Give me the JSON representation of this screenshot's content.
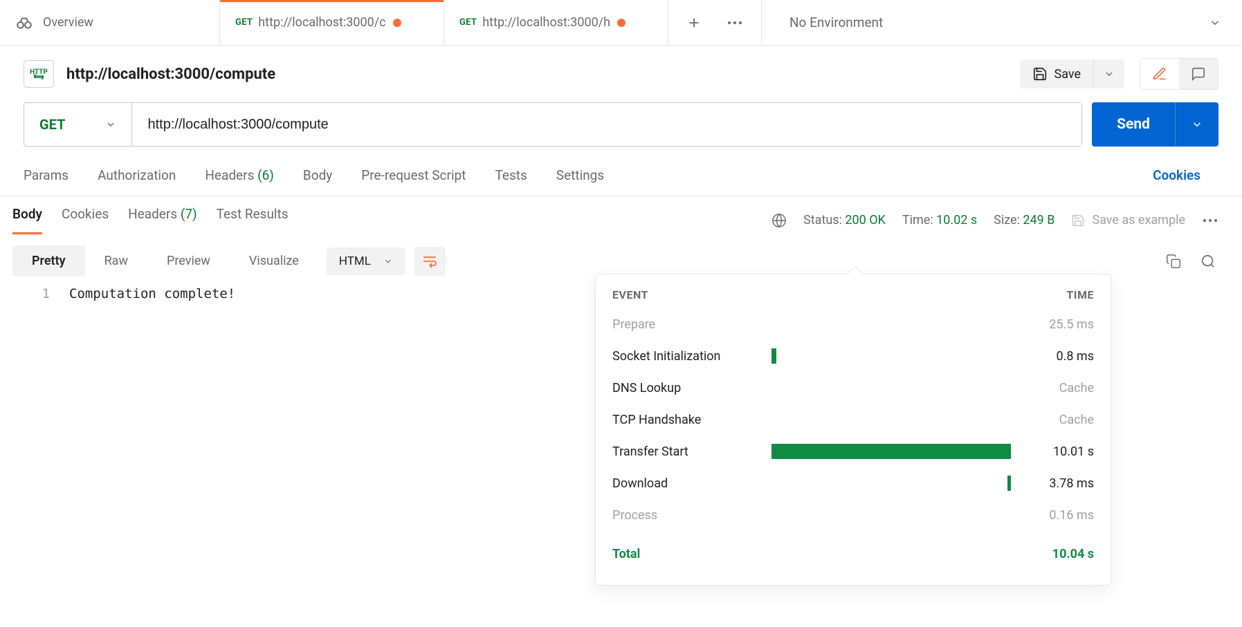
{
  "tabs": {
    "overview": "Overview",
    "items": [
      {
        "method": "GET",
        "label": "http://localhost:3000/c"
      },
      {
        "method": "GET",
        "label": "http://localhost:3000/h"
      }
    ]
  },
  "env": {
    "label": "No Environment"
  },
  "request": {
    "http_badge": "HTTP",
    "title": "http://localhost:3000/compute",
    "save_label": "Save",
    "method": "GET",
    "url": "http://localhost:3000/compute",
    "send": "Send"
  },
  "req_tabs": {
    "params": "Params",
    "authorization": "Authorization",
    "headers_label": "Headers",
    "headers_count": "(6)",
    "body": "Body",
    "prerequest": "Pre-request Script",
    "tests": "Tests",
    "settings": "Settings",
    "cookies": "Cookies"
  },
  "resp_tabs": {
    "body": "Body",
    "cookies": "Cookies",
    "headers_label": "Headers",
    "headers_count": "(7)",
    "test_results": "Test Results"
  },
  "resp_meta": {
    "status_label": "Status:",
    "status_val": "200 OK",
    "time_label": "Time:",
    "time_val": "10.02 s",
    "size_label": "Size:",
    "size_val": "249 B",
    "save_example": "Save as example"
  },
  "body_ctrl": {
    "pretty": "Pretty",
    "raw": "Raw",
    "preview": "Preview",
    "visualize": "Visualize",
    "format": "HTML"
  },
  "code": {
    "line_no": "1",
    "line_text": "Computation complete!"
  },
  "time_pop": {
    "event_head": "EVENT",
    "time_head": "TIME",
    "rows": [
      {
        "event": "Prepare",
        "value": "25.5 ms",
        "dim": true,
        "left": 0,
        "width": 0
      },
      {
        "event": "Socket Initialization",
        "value": "0.8 ms",
        "dim": false,
        "left": 0,
        "width": 2
      },
      {
        "event": "DNS Lookup",
        "value": "Cache",
        "dim": false,
        "valdim": true,
        "left": 0,
        "width": 0
      },
      {
        "event": "TCP Handshake",
        "value": "Cache",
        "dim": false,
        "valdim": true,
        "left": 0,
        "width": 0
      },
      {
        "event": "Transfer Start",
        "value": "10.01 s",
        "dim": false,
        "left": 0,
        "width": 100
      },
      {
        "event": "Download",
        "value": "3.78 ms",
        "dim": false,
        "left": 98.5,
        "width": 1.5
      },
      {
        "event": "Process",
        "value": "0.16 ms",
        "dim": true,
        "left": 0,
        "width": 0
      }
    ],
    "total_label": "Total",
    "total_value": "10.04 s"
  }
}
